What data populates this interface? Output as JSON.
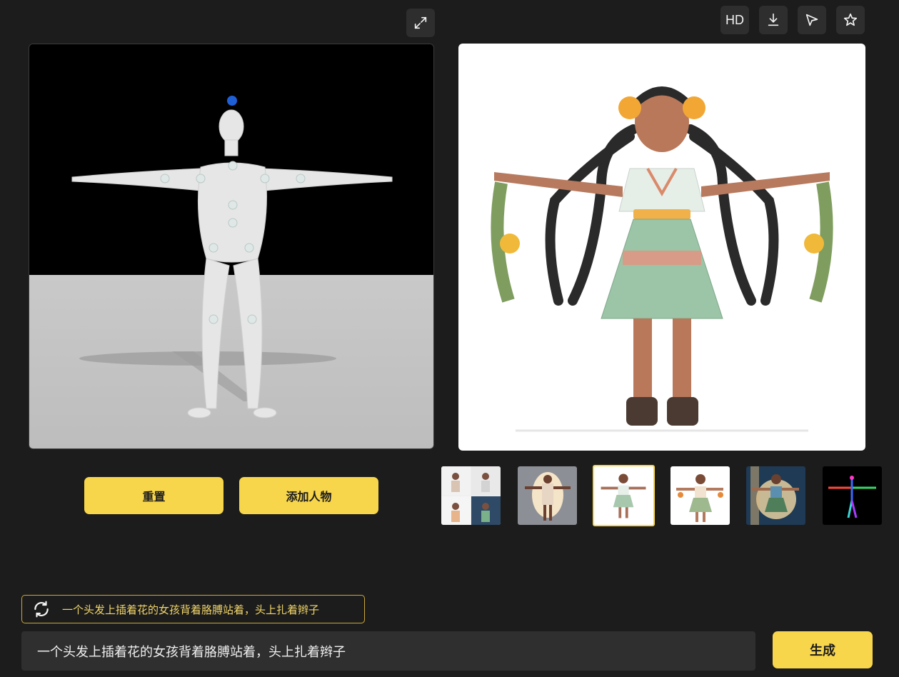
{
  "toolbar": {
    "expand_icon": "expand-icon",
    "hd_label": "HD",
    "download_icon": "download-icon",
    "send_icon": "send-icon",
    "favorite_icon": "star-icon"
  },
  "pose_editor": {
    "reset_label": "重置",
    "add_person_label": "添加人物"
  },
  "thumbnails": [
    {
      "name": "thumb-grid",
      "selected": false
    },
    {
      "name": "thumb-glow",
      "selected": false
    },
    {
      "name": "thumb-girl-white",
      "selected": true
    },
    {
      "name": "thumb-girl-flowers",
      "selected": false
    },
    {
      "name": "thumb-girl-blue",
      "selected": false
    },
    {
      "name": "thumb-skeleton",
      "selected": false
    }
  ],
  "prompt": {
    "history_text": "一个头发上插着花的女孩背着胳膊站着，头上扎着辫子",
    "input_value": "一个头发上插着花的女孩背着胳膊站着，头上扎着辫子",
    "generate_label": "生成"
  },
  "colors": {
    "accent": "#f8d64b",
    "background": "#1c1c1c",
    "panel": "#2e2e2e"
  }
}
